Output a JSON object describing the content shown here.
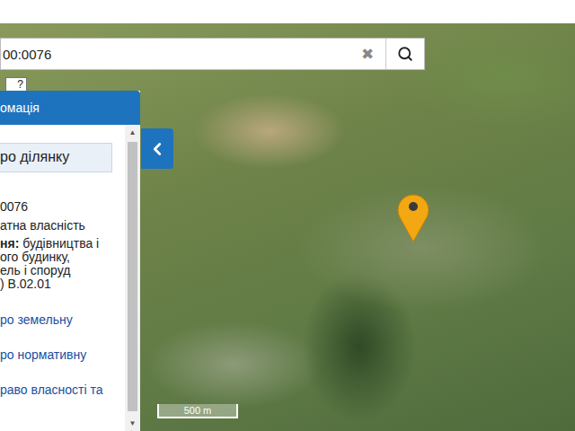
{
  "search": {
    "value": "00:0076",
    "clear": "✖"
  },
  "help": "?",
  "panel": {
    "header": "омація",
    "tab": "ро ділянку",
    "fields": [
      "0076",
      "атна власність"
    ],
    "purpose": {
      "label": "ня:",
      "lines": [
        "будівництва і",
        "ого будинку,",
        "ель і споруд",
        ") В.02.01"
      ]
    },
    "links": [
      "ро земельну",
      "ро нормативну",
      "раво власності та"
    ],
    "scroll_up": "▲",
    "scroll_down": "▼"
  },
  "map": {
    "scale": "500 m"
  }
}
